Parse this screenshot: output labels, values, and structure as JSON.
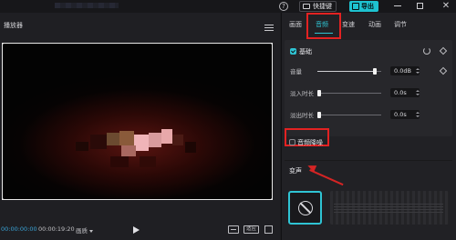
{
  "topbar": {
    "help_glyph": "?",
    "shortcut_label": "快捷键",
    "export_label": "导出",
    "close_glyph": "✕",
    "icons": [
      "help-icon",
      "keyboard-icon",
      "export-icon",
      "minimize-icon",
      "maximize-icon",
      "close-icon"
    ]
  },
  "player": {
    "title": "播放器",
    "current_time": "00:00:00:00",
    "duration": "00:00:19:20",
    "quality": "画质",
    "ratio_label": "适应"
  },
  "panel": {
    "tabs": [
      {
        "label": "画面",
        "active": false
      },
      {
        "label": "音频",
        "active": true
      },
      {
        "label": "变速",
        "active": false
      },
      {
        "label": "动画",
        "active": false
      },
      {
        "label": "调节",
        "active": false
      }
    ],
    "basic": {
      "label": "基础",
      "checked": true,
      "rows": [
        {
          "label": "音量",
          "value": "0.0dB",
          "slider_fraction": 0.9
        },
        {
          "label": "淡入时长",
          "value": "0.0s",
          "slider_fraction": 0.0
        },
        {
          "label": "淡出时长",
          "value": "0.0s",
          "slider_fraction": 0.0
        }
      ]
    },
    "noise_reduction": {
      "label": "音频降噪",
      "checked": false
    },
    "voice_change": {
      "label": "变声"
    }
  },
  "annotation_color": "#e32222",
  "accent_color": "#2fc4d4"
}
